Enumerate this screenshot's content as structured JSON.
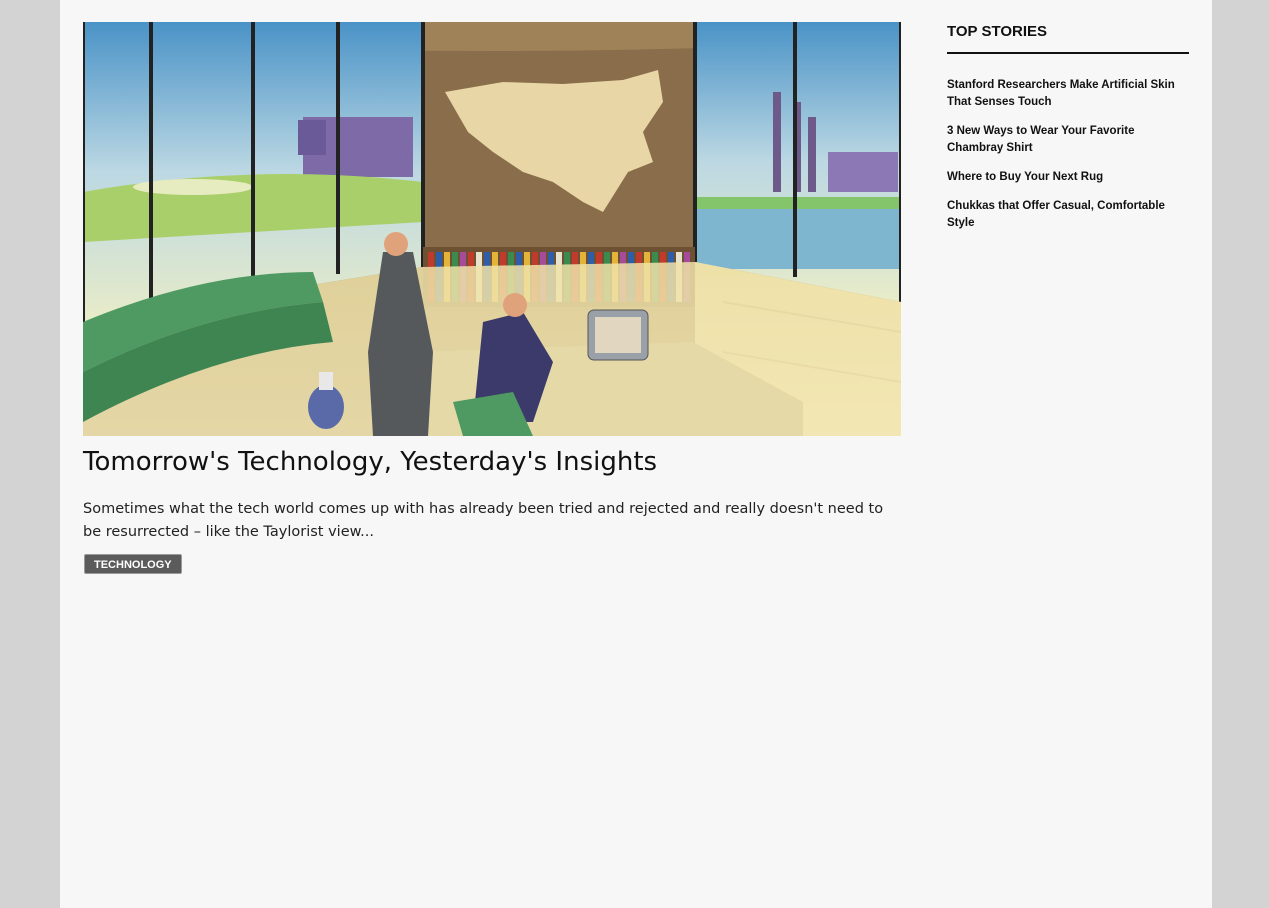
{
  "article": {
    "title": "Tomorrow's Technology, Yesterday's Insights",
    "excerpt": "Sometimes what the tech world comes up with has already been tried and rejected and really doesn't need to be resurrected – like the Taylorist view...",
    "tag": "TECHNOLOGY",
    "image_description": "retro office illustration"
  },
  "sidebar": {
    "heading": "TOP STORIES",
    "stories": [
      "Stanford Researchers Make Artificial Skin That Senses Touch",
      "3 New Ways to Wear Your Favorite Chambray Shirt",
      "Where to Buy Your Next Rug",
      "Chukkas that Offer Casual, Comfortable Style"
    ]
  },
  "colors": {
    "background": "#d3d3d3",
    "page": "#f8f7f8",
    "tag_bg": "#5b5b5b",
    "text": "#111111"
  }
}
